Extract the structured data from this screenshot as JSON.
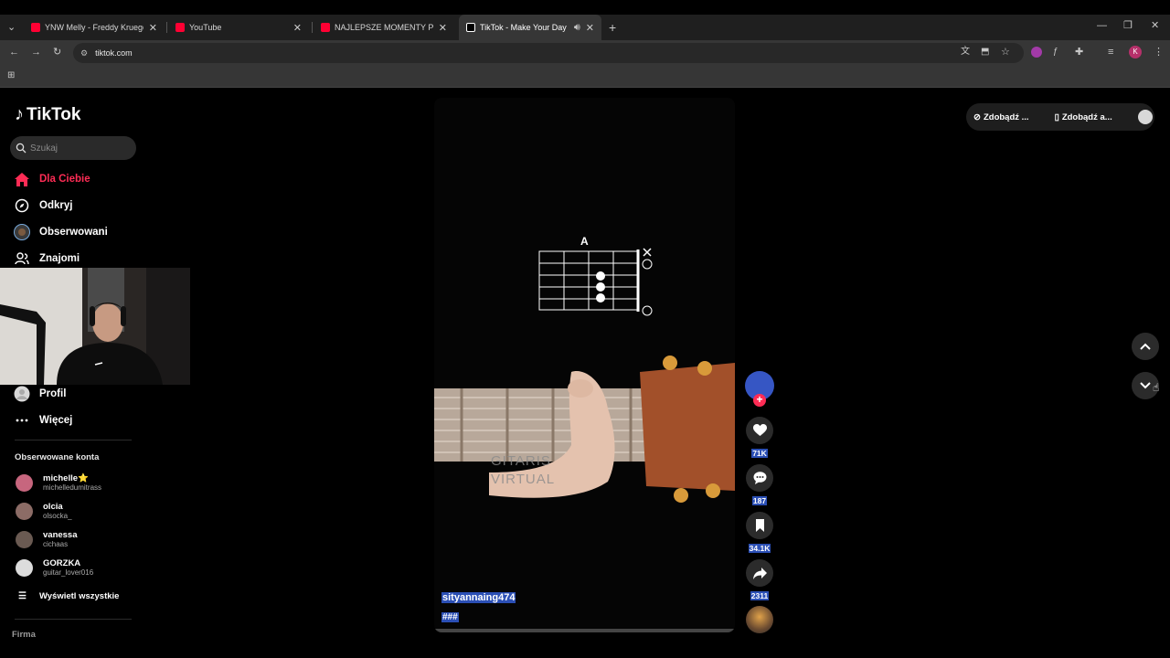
{
  "browser": {
    "tabs": [
      {
        "title": "YNW Melly - Freddy Krueger (",
        "icon": "youtube-icon",
        "active": false
      },
      {
        "title": "YouTube",
        "icon": "youtube-icon",
        "active": false
      },
      {
        "title": "NAJLEPSZE MOMENTY POLSKI",
        "icon": "youtube-icon",
        "active": false
      },
      {
        "title": "TikTok - Make Your Day",
        "icon": "tiktok-icon",
        "active": true
      }
    ],
    "url": "tiktok.com",
    "profile_initial": "K"
  },
  "sidebar": {
    "logo_text": "TikTok",
    "search_placeholder": "Szukaj",
    "nav": [
      {
        "label": "Dla Ciebie",
        "icon": "home-icon",
        "active": true
      },
      {
        "label": "Odkryj",
        "icon": "compass-icon",
        "active": false
      },
      {
        "label": "Obserwowani",
        "icon": "following-avatar-icon",
        "active": false
      },
      {
        "label": "Znajomi",
        "icon": "friends-icon",
        "active": false
      },
      {
        "label": "Profil",
        "icon": "profile-icon",
        "active": false
      },
      {
        "label": "Więcej",
        "icon": "more-icon",
        "active": false
      }
    ],
    "followed_heading": "Obserwowane konta",
    "followed": [
      {
        "name": "michelle⭐",
        "handle": "michelledumitrass",
        "color": "#c7667e"
      },
      {
        "name": "olcia",
        "handle": "olsocka_",
        "color": "#8c6c66"
      },
      {
        "name": "vanessa",
        "handle": "cichaas",
        "color": "#6a5a52"
      },
      {
        "name": "GORZKA",
        "handle": "guitar_lover016",
        "color": "#dcdcdc"
      }
    ],
    "show_all": "Wyświetl wszystkie",
    "footer": "Firma"
  },
  "video": {
    "chord": "A",
    "watermark": "GITARIS VIRTUAL",
    "username": "sityannaing474",
    "tags": "###"
  },
  "actions": {
    "likes": "71K",
    "comments": "187",
    "saves": "34.1K",
    "shares": "2311"
  },
  "topright": {
    "get_coins": "Zdobądź ...",
    "get_app": "Zdobądź a..."
  },
  "colors": {
    "accent": "#fe2c55",
    "highlight": "#2b4fb5"
  }
}
